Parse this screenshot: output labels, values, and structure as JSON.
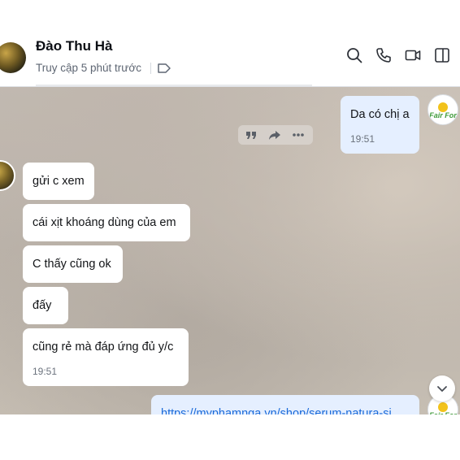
{
  "header": {
    "contact_name": "Đào Thu Hà",
    "status": "Truy cập 5 phút trước",
    "icons": [
      "tag-icon",
      "search-icon",
      "phone-icon",
      "video-icon",
      "sidebar-toggle-icon"
    ]
  },
  "messages": {
    "me_first": {
      "text": "Da có chị a",
      "time": "19:51"
    },
    "them": [
      {
        "text": "gửi c xem"
      },
      {
        "text": "cái xịt khoáng dùng của em"
      },
      {
        "text": "C thấy cũng ok"
      },
      {
        "text": "đấy"
      },
      {
        "text": "cũng rẻ mà đáp ứng đủ y/c",
        "time": "19:51"
      }
    ],
    "me_link": {
      "text": "https://myphamnga.vn/shop/serum-natura-si"
    }
  },
  "avatars": {
    "fair_label": "Fair For"
  },
  "colors": {
    "my_bubble": "#e5efff",
    "their_bubble": "#ffffff",
    "link": "#1a6ad9"
  }
}
